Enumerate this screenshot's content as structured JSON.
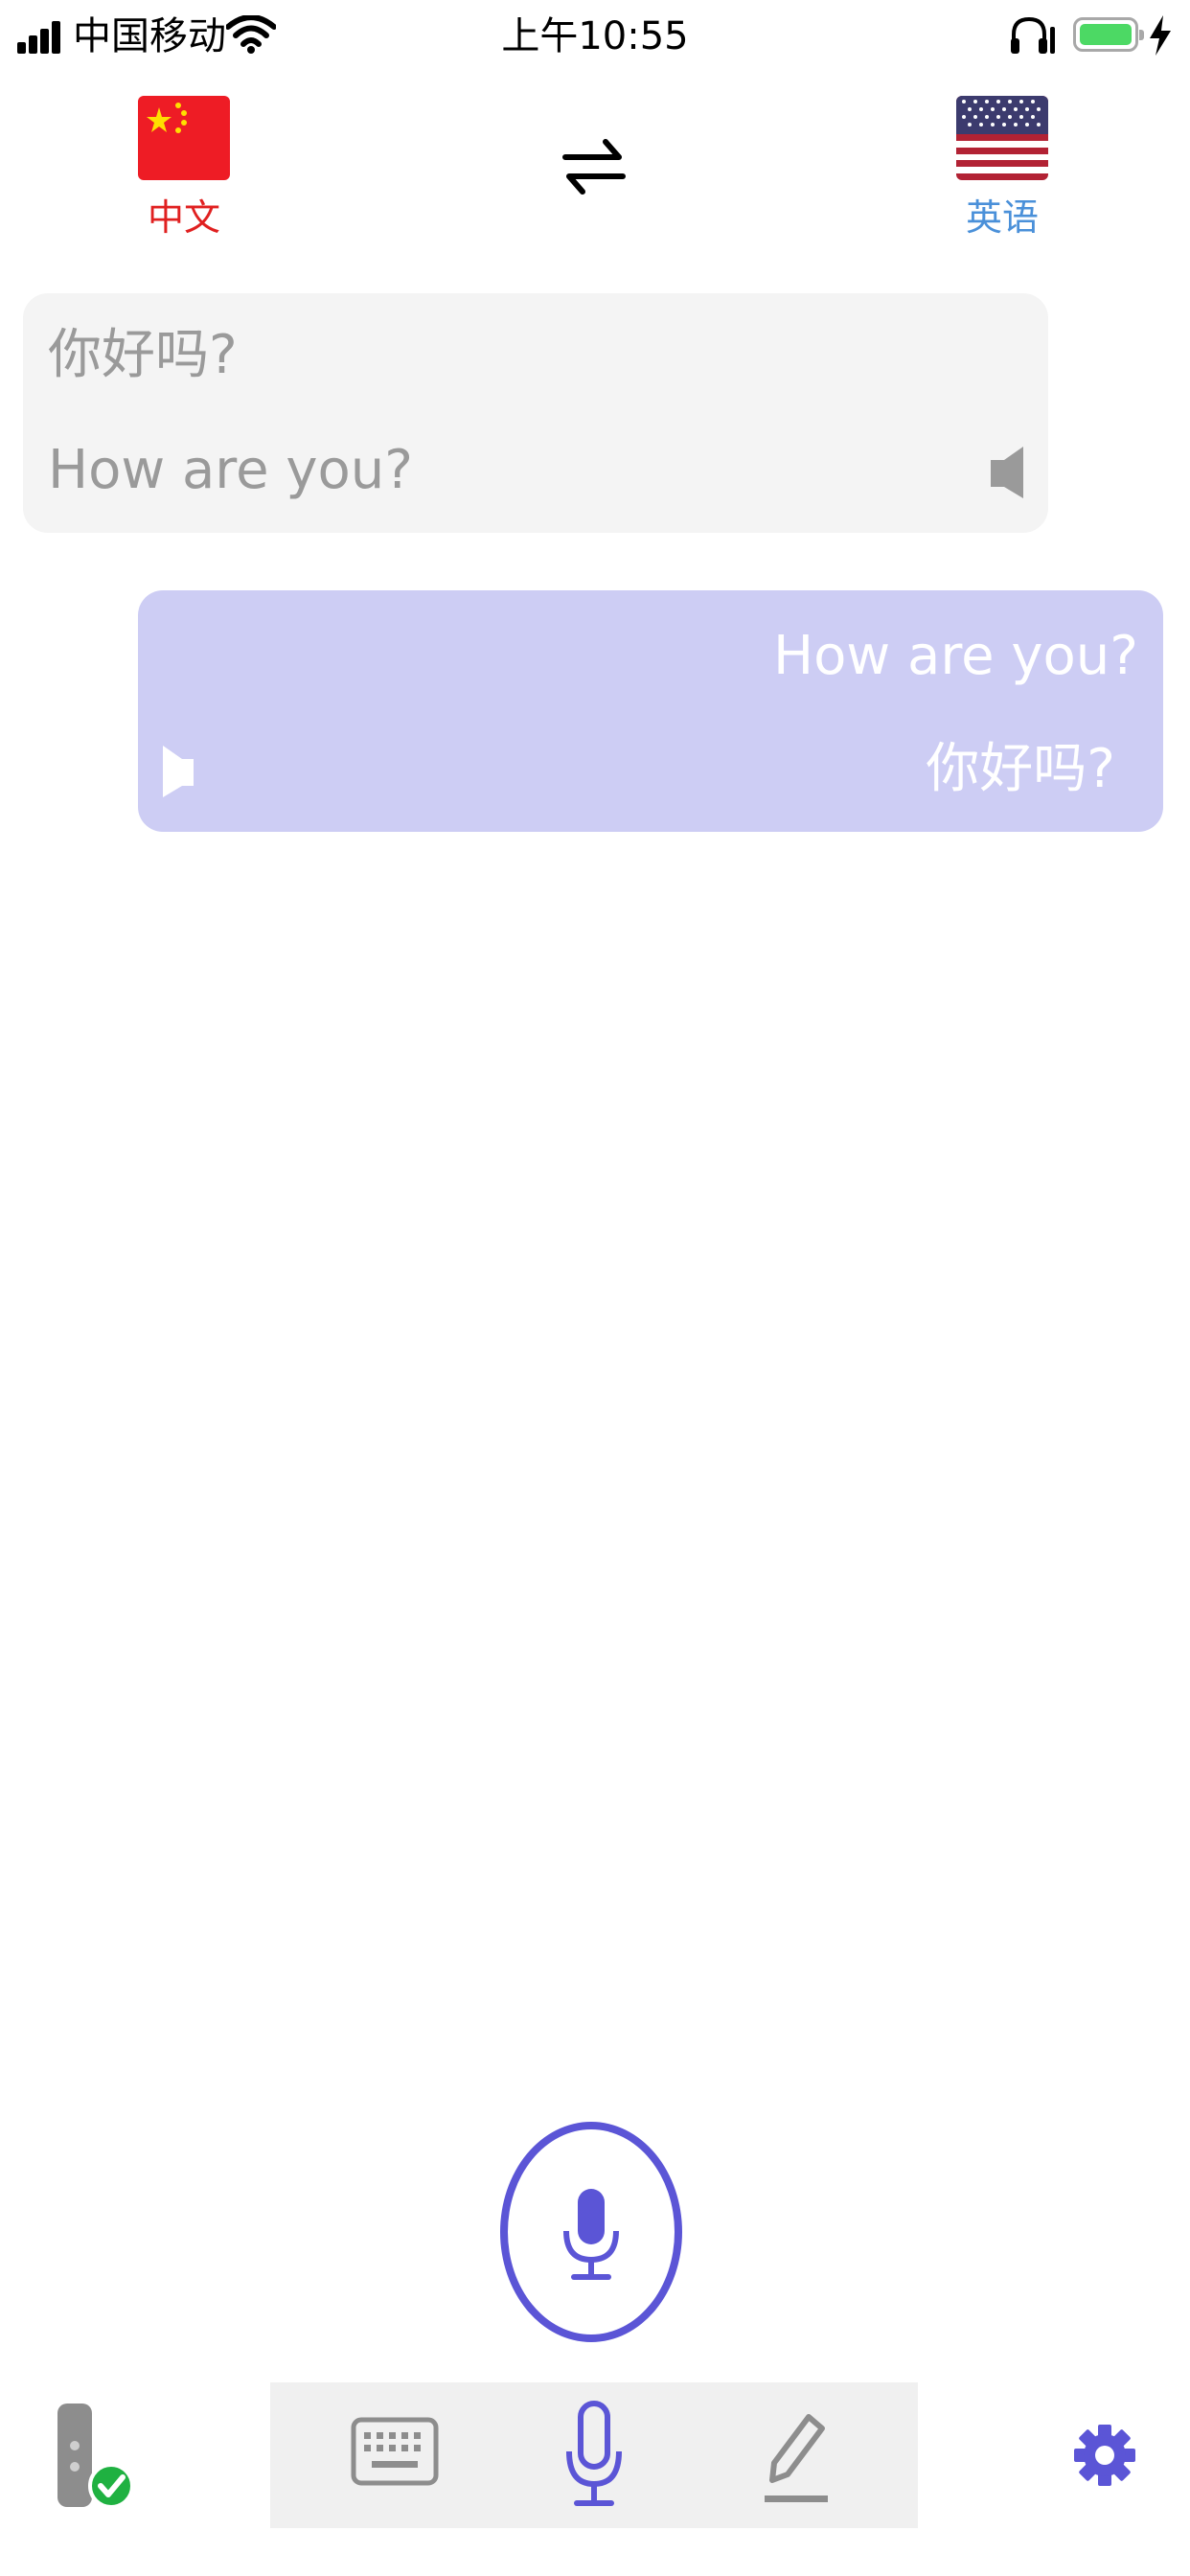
{
  "status_bar": {
    "carrier": "中国移动",
    "time": "上午10:55",
    "battery_color": "#4cd964"
  },
  "languages": {
    "source": {
      "label": "中文",
      "flag": "china-flag",
      "color": "#e02020"
    },
    "target": {
      "label": "英语",
      "flag": "usa-flag",
      "color": "#4a90d9"
    }
  },
  "conversation": [
    {
      "side": "left",
      "original": "你好吗?",
      "translation": "How are you?",
      "background": "#f4f4f4"
    },
    {
      "side": "right",
      "original": "How are you?",
      "translation": "你好吗?",
      "background": "#cdcdf4"
    }
  ],
  "toolbar": {
    "icons": [
      "device-status-icon",
      "keyboard-icon",
      "microphone-icon",
      "pen-icon",
      "settings-gear-icon"
    ],
    "accent": "#5b55d6"
  }
}
